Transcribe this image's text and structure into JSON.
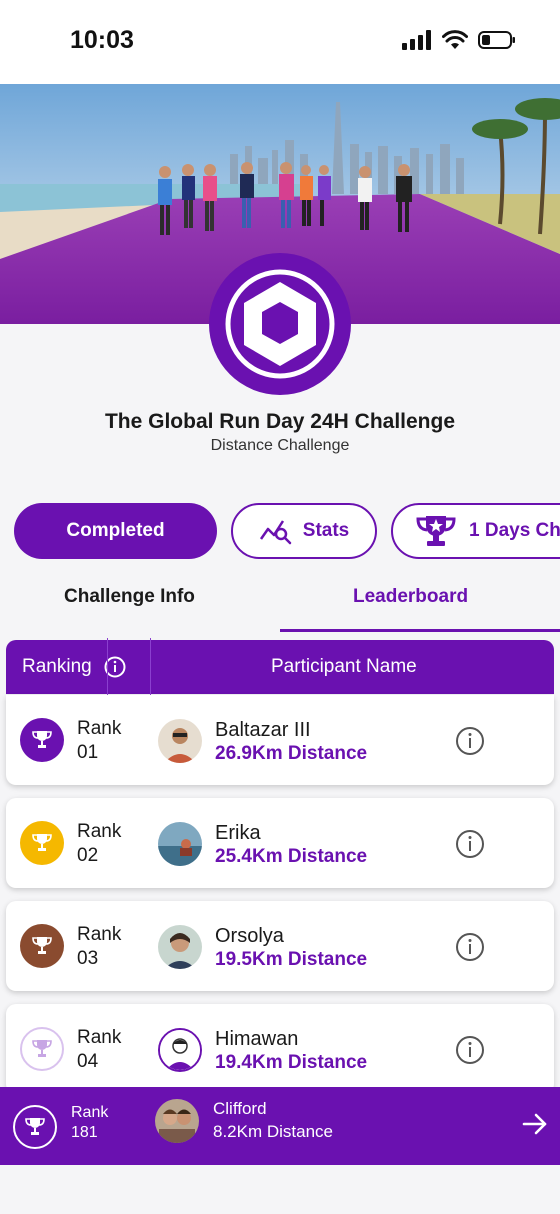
{
  "status_bar": {
    "time": "10:03"
  },
  "challenge": {
    "title": "The Global Run Day 24H Challenge",
    "subtitle": "Distance Challenge"
  },
  "chips": {
    "completed": "Completed",
    "stats": "Stats",
    "days": "1 Days Ch"
  },
  "tabs": {
    "info": "Challenge Info",
    "leaderboard": "Leaderboard"
  },
  "table": {
    "col_ranking": "Ranking",
    "col_name": "Participant Name"
  },
  "leaderboard": [
    {
      "rank_word": "Rank",
      "rank": "01",
      "name": "Baltazar III",
      "distance": "26.9Km Distance",
      "badge_color": "#6a11b0"
    },
    {
      "rank_word": "Rank",
      "rank": "02",
      "name": "Erika",
      "distance": "25.4Km Distance",
      "badge_color": "#f5b800"
    },
    {
      "rank_word": "Rank",
      "rank": "03",
      "name": "Orsolya",
      "distance": "19.5Km Distance",
      "badge_color": "#8a4b2f"
    },
    {
      "rank_word": "Rank",
      "rank": "04",
      "name": "Himawan",
      "distance": "19.4Km Distance",
      "badge_color": "#d9c2ee"
    }
  ],
  "my_rank": {
    "rank_word": "Rank",
    "rank": "181",
    "name": "Clifford",
    "distance": "8.2Km Distance"
  },
  "colors": {
    "primary": "#6a11b0",
    "gold": "#f5b800",
    "bronze": "#8a4b2f"
  }
}
